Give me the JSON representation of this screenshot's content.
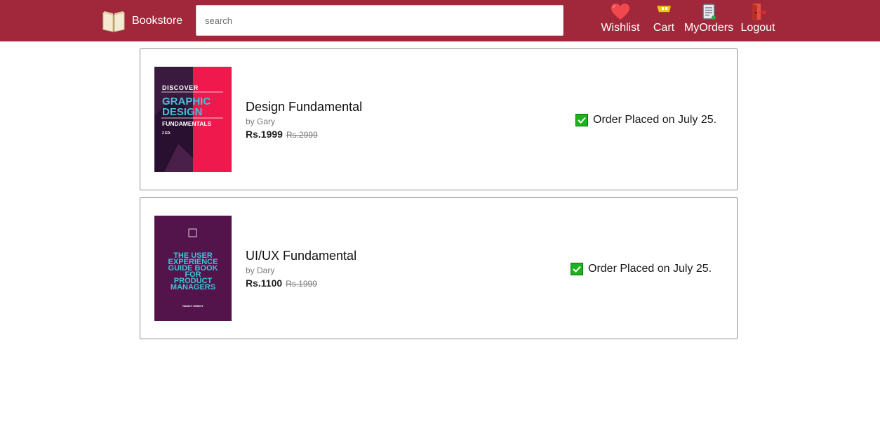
{
  "header": {
    "brand": "Bookstore",
    "search_placeholder": "search",
    "nav": [
      {
        "label": "Wishlist",
        "icon": "heart-icon"
      },
      {
        "label": "Cart",
        "icon": "cart-icon"
      },
      {
        "label": "MyOrders",
        "icon": "orders-icon"
      },
      {
        "label": "Logout",
        "icon": "logout-icon"
      }
    ]
  },
  "orders": [
    {
      "title": "Design Fundamental",
      "author": "by Gary",
      "price": "Rs.1999",
      "original_price": "Rs.2999",
      "status": "Order Placed on July 25.",
      "cover": {
        "line1": "DISCOVER",
        "line2": "GRAPHIC",
        "line3": "DESIGN",
        "line4": "FUNDAMENTALS",
        "edition": "2 ED."
      }
    },
    {
      "title": "UI/UX Fundamental",
      "author": "by Dary",
      "price": "Rs.1100",
      "original_price": "Rs.1999",
      "status": "Order Placed on July 25.",
      "cover": {
        "line1": "THE USER",
        "line2": "EXPERIENCE",
        "line3": "GUIDE BOOK",
        "line4": "FOR",
        "line5": "PRODUCT",
        "line6": "MANAGERS",
        "author_name": "NANCY DEBOY"
      }
    }
  ],
  "colors": {
    "header_bg": "#a0283a",
    "check_green": "#1db31d",
    "cover1_pink": "#f0194e",
    "cover1_dark": "#3a1a3e",
    "cover2_purple": "#5a1650",
    "cover_teal": "#3fc4d9"
  }
}
